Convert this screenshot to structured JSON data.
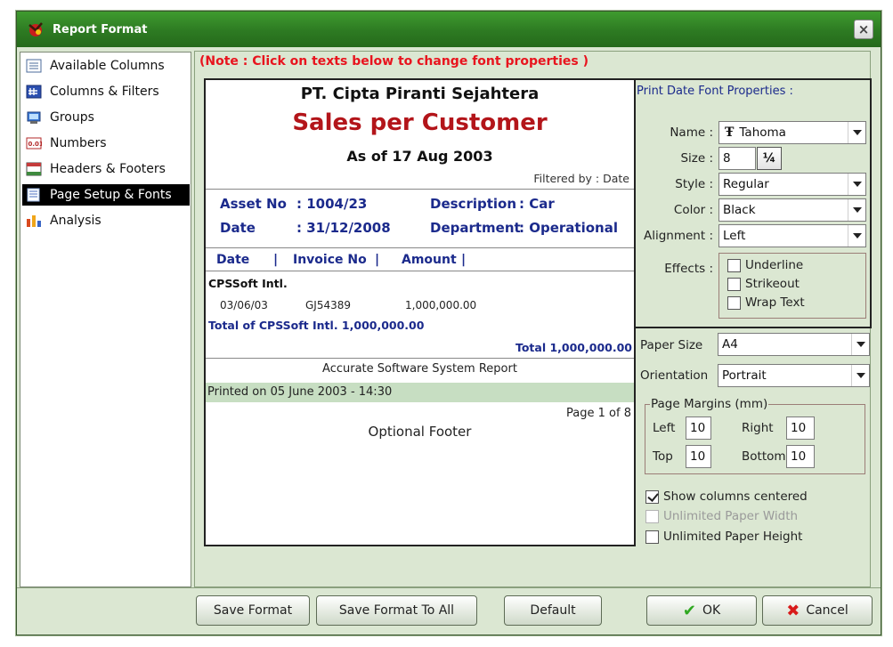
{
  "window": {
    "title": "Report Format",
    "close_glyph": "×"
  },
  "sidebar": {
    "items": [
      {
        "label": "Available Columns",
        "icon": "columns-list-icon",
        "selected": false
      },
      {
        "label": "Columns & Filters",
        "icon": "filter-grid-icon",
        "selected": false
      },
      {
        "label": "Groups",
        "icon": "groups-icon",
        "selected": false
      },
      {
        "label": "Numbers",
        "icon": "numbers-icon",
        "selected": false
      },
      {
        "label": "Headers & Footers",
        "icon": "headers-footers-icon",
        "selected": false
      },
      {
        "label": "Page Setup & Fonts",
        "icon": "page-setup-icon",
        "selected": true
      },
      {
        "label": "Analysis",
        "icon": "analysis-chart-icon",
        "selected": false
      }
    ]
  },
  "note": "(Note : Click on texts below to change font properties )",
  "preview": {
    "company": "PT. Cipta Piranti Sejahtera",
    "report_title": "Sales per Customer",
    "as_of": "As of 17 Aug 2003",
    "filtered_by": "Filtered by : Date",
    "fields": {
      "asset_label": "Asset No",
      "asset_value": ": 1004/23",
      "description_label": "Description",
      "description_value": ": Car",
      "date_label": "Date",
      "date_value": ": 31/12/2008",
      "department_label": "Department",
      "department_value": ": Operational"
    },
    "columns": {
      "date": "Date",
      "sep1": "|",
      "invoice": "Invoice No",
      "sep2": "|",
      "amount": "Amount",
      "sep3": "|"
    },
    "group_name": "CPSSoft Intl.",
    "row": {
      "date": "03/06/03",
      "invoice": "GJ54389",
      "amount": "1,000,000.00"
    },
    "group_total": "Total of CPSSoft Intl. 1,000,000.00",
    "grand_total": "Total 1,000,000.00",
    "report_footer": "Accurate Software System Report",
    "printed_on": "Printed on 05 June 2003 - 14:30",
    "page": "Page 1 of 8",
    "optional_footer": "Optional Footer"
  },
  "font_props": {
    "title": "Print Date Font Properties :",
    "name_label": "Name :",
    "name_value": "Tahoma",
    "size_label": "Size :",
    "size_value": "8",
    "size_btn": "¼",
    "style_label": "Style :",
    "style_value": "Regular",
    "color_label": "Color :",
    "color_value": "Black",
    "alignment_label": "Alignment :",
    "alignment_value": "Left",
    "effects_label": "Effects :",
    "effects": [
      {
        "label": "Underline",
        "checked": false
      },
      {
        "label": "Strikeout",
        "checked": false
      },
      {
        "label": "Wrap Text",
        "checked": false
      }
    ]
  },
  "page_setup": {
    "paper_size_label": "Paper Size",
    "paper_size_value": "A4",
    "orientation_label": "Orientation",
    "orientation_value": "Portrait",
    "margins_legend": "Page Margins (mm)",
    "left_label": "Left",
    "left_value": "10",
    "right_label": "Right",
    "right_value": "10",
    "top_label": "Top",
    "top_value": "10",
    "bottom_label": "Bottom",
    "bottom_value": "10",
    "show_centered": {
      "label": "Show columns centered",
      "checked": true
    },
    "unlimited_width": {
      "label": "Unlimited Paper Width",
      "checked": false,
      "disabled": true
    },
    "unlimited_height": {
      "label": "Unlimited Paper Height",
      "checked": false
    }
  },
  "buttons": {
    "save_format": "Save Format",
    "save_format_all": "Save Format To All",
    "default": "Default",
    "ok": "OK",
    "cancel": "Cancel"
  },
  "colors": {
    "title_bar": "#2d7a22",
    "note_red": "#e8141e",
    "report_title": "#b3151a",
    "label_blue": "#1b2a8c",
    "ok_check": "#2fa821",
    "cancel_x": "#d81b1b"
  }
}
